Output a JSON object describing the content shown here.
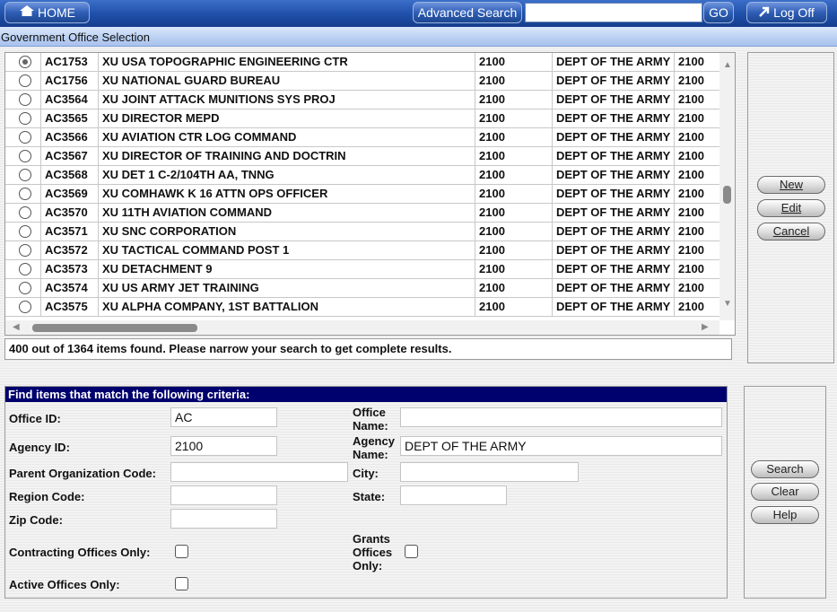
{
  "header": {
    "home_label": "HOME",
    "advanced_search_label": "Advanced Search",
    "search_value": "",
    "go_label": "GO",
    "logoff_label": "Log Off"
  },
  "page_title": "Government Office Selection",
  "list": {
    "selected_index": 0,
    "rows": [
      {
        "id": "AC1753",
        "name": "XU USA TOPOGRAPHIC ENGINEERING CTR",
        "agency_id": "2100",
        "agency": "DEPT OF THE ARMY",
        "code": "2100"
      },
      {
        "id": "AC1756",
        "name": "XU NATIONAL GUARD BUREAU",
        "agency_id": "2100",
        "agency": "DEPT OF THE ARMY",
        "code": "2100"
      },
      {
        "id": "AC3564",
        "name": "XU JOINT ATTACK MUNITIONS SYS PROJ",
        "agency_id": "2100",
        "agency": "DEPT OF THE ARMY",
        "code": "2100"
      },
      {
        "id": "AC3565",
        "name": "XU DIRECTOR MEPD",
        "agency_id": "2100",
        "agency": "DEPT OF THE ARMY",
        "code": "2100"
      },
      {
        "id": "AC3566",
        "name": "XU AVIATION CTR LOG COMMAND",
        "agency_id": "2100",
        "agency": "DEPT OF THE ARMY",
        "code": "2100"
      },
      {
        "id": "AC3567",
        "name": "XU DIRECTOR OF TRAINING AND DOCTRIN",
        "agency_id": "2100",
        "agency": "DEPT OF THE ARMY",
        "code": "2100"
      },
      {
        "id": "AC3568",
        "name": "XU DET 1 C-2/104TH AA, TNNG",
        "agency_id": "2100",
        "agency": "DEPT OF THE ARMY",
        "code": "2100"
      },
      {
        "id": "AC3569",
        "name": "XU COMHAWK K 16 ATTN OPS OFFICER",
        "agency_id": "2100",
        "agency": "DEPT OF THE ARMY",
        "code": "2100"
      },
      {
        "id": "AC3570",
        "name": "XU 11TH AVIATION COMMAND",
        "agency_id": "2100",
        "agency": "DEPT OF THE ARMY",
        "code": "2100"
      },
      {
        "id": "AC3571",
        "name": "XU SNC CORPORATION",
        "agency_id": "2100",
        "agency": "DEPT OF THE ARMY",
        "code": "2100"
      },
      {
        "id": "AC3572",
        "name": "XU TACTICAL COMMAND POST 1",
        "agency_id": "2100",
        "agency": "DEPT OF THE ARMY",
        "code": "2100"
      },
      {
        "id": "AC3573",
        "name": "XU DETACHMENT 9",
        "agency_id": "2100",
        "agency": "DEPT OF THE ARMY",
        "code": "2100"
      },
      {
        "id": "AC3574",
        "name": "XU US ARMY JET TRAINING",
        "agency_id": "2100",
        "agency": "DEPT OF THE ARMY",
        "code": "2100"
      },
      {
        "id": "AC3575",
        "name": "XU ALPHA COMPANY, 1ST BATTALION",
        "agency_id": "2100",
        "agency": "DEPT OF THE ARMY",
        "code": "2100"
      }
    ],
    "message": "400 out of 1364 items found. Please narrow your search to get complete results."
  },
  "list_actions": {
    "new_label": "New",
    "edit_label": "Edit",
    "cancel_label": "Cancel"
  },
  "criteria": {
    "title": "Find items that match the following criteria:",
    "office_id_label": "Office ID:",
    "office_id_value": "AC",
    "office_name_label_1": "Office",
    "office_name_label_2": "Name:",
    "office_name_value": "",
    "agency_id_label": "Agency ID:",
    "agency_id_value": "2100",
    "agency_name_label_1": "Agency",
    "agency_name_label_2": "Name:",
    "agency_name_value": "DEPT OF THE ARMY",
    "parent_org_label": "Parent Organization Code:",
    "parent_org_value": "",
    "city_label": "City:",
    "city_value": "",
    "region_label": "Region Code:",
    "region_value": "",
    "state_label": "State:",
    "state_value": "",
    "zip_label": "Zip Code:",
    "zip_value": "",
    "contracting_label": "Contracting Offices Only:",
    "grants_label_1": "Grants",
    "grants_label_2": "Offices",
    "grants_label_3": "Only:",
    "active_label": "Active Offices Only:"
  },
  "criteria_actions": {
    "search_label": "Search",
    "clear_label": "Clear",
    "help_label": "Help"
  },
  "icons": {
    "home": "house-icon",
    "logoff": "arrow-up-right-icon"
  }
}
